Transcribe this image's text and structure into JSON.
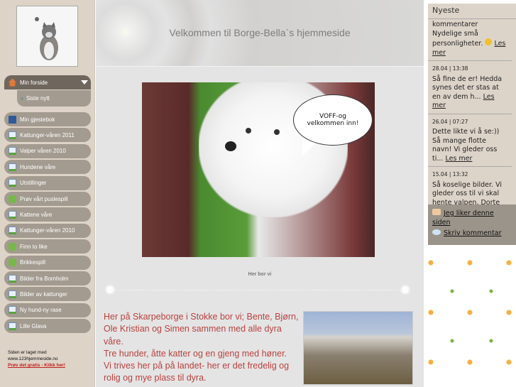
{
  "sidebar": {
    "active": {
      "label": "Min forside",
      "icon": "home-icon"
    },
    "sub": {
      "label": "Siste nytt",
      "icon": "page-icon"
    },
    "items": [
      {
        "label": "Min gjestebok",
        "icon": "book-icon"
      },
      {
        "label": "Kattunger-våren 2011",
        "icon": "page-icon"
      },
      {
        "label": "Valper våren 2010",
        "icon": "page-icon"
      },
      {
        "label": "Hundene våre",
        "icon": "page-icon"
      },
      {
        "label": "Utstillinger",
        "icon": "page-icon"
      },
      {
        "label": "Prøv vårt puslespill",
        "icon": "puzzle-icon"
      },
      {
        "label": "Kattene våre",
        "icon": "page-icon"
      },
      {
        "label": "Kattunger-våren 2010",
        "icon": "page-icon"
      },
      {
        "label": "Finn to like",
        "icon": "puzzle-icon"
      },
      {
        "label": "Brikkespill",
        "icon": "puzzle-icon"
      },
      {
        "label": "Bilder fra Bornholm",
        "icon": "gallery-icon"
      },
      {
        "label": "Bilder av kattunger",
        "icon": "page-icon"
      },
      {
        "label": "Ny hund-ny rase",
        "icon": "page-icon"
      },
      {
        "label": "Lille Glava",
        "icon": "page-icon"
      }
    ],
    "footer": {
      "line1": "Siden er laget med",
      "line2": "www.123hjemmeside.no",
      "link": "Prøv det gratis - Klikk her!"
    }
  },
  "main": {
    "title": "Velkommen til Borge-Bella`s hjemmeside",
    "bubble": "VOFF-og velkommen inn!",
    "caption": "Her bor vi",
    "paragraph": [
      "Her på Skarpeborge i Stokke bor vi; Bente, Bjørn, Ole Kristian og Simen  sammen med alle dyra våre.",
      "Tre hunder, åtte katter og en gjeng med høner.",
      "Vi trives her på på landet- her er det fredelig og rolig og mye plass til dyra."
    ]
  },
  "comments": {
    "title": "Nyeste",
    "subtitle": "kommentarer",
    "read_more": "Les mer",
    "items": [
      {
        "date": "",
        "text": "Nydelige små personligheter."
      },
      {
        "date": "28.04 | 13:38",
        "text": "Så fine de er! Hedda synes det er stas at en av dem h..."
      },
      {
        "date": "26.04 | 07:27",
        "text": "Dette likte vi å se:)) Så mange flotte navn! Vi gleder oss ti..."
      },
      {
        "date": "15.04 | 13:32",
        "text": "Så koselige bilder. Vi gleder oss til vi skal hente valpen. Dorte"
      }
    ],
    "like": "Jeg liker denne siden",
    "write": "Skriv kommentar"
  }
}
